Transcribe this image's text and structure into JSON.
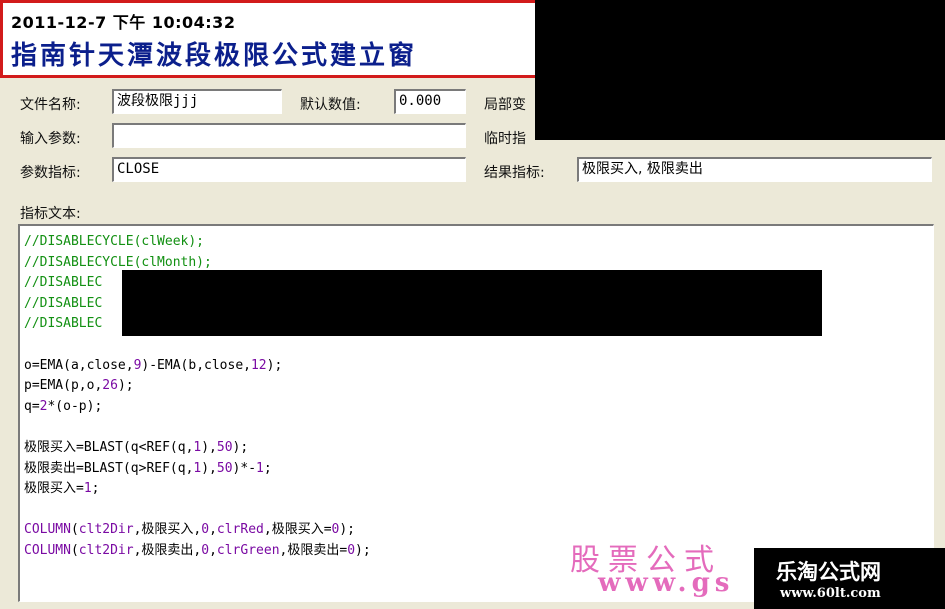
{
  "header": {
    "timestamp": "2011-12-7 下午 10:04:32",
    "title": "指南针天潭波段极限公式建立窗"
  },
  "form": {
    "file_name_label": "文件名称:",
    "file_name_value": "波段极限jjj",
    "default_value_label": "默认数值:",
    "default_value_value": "0.000",
    "local_var_label": "局部变",
    "input_params_label": "输入参数:",
    "input_params_value": "",
    "temp_label": "临时指",
    "param_index_label": "参数指标:",
    "param_index_value": "CLOSE",
    "result_index_label": "结果指标:",
    "result_index_value": "极限买入, 极限卖出",
    "index_text_label": "指标文本:"
  },
  "code": {
    "lines": [
      [
        {
          "t": "//DISABLECYCLE(clWeek);",
          "c": "cmt"
        }
      ],
      [
        {
          "t": "//DISABLECYCLE(clMonth);",
          "c": "cmt"
        }
      ],
      [
        {
          "t": "//DISABLEC",
          "c": "cmt"
        }
      ],
      [
        {
          "t": "//DISABLEC",
          "c": "cmt"
        }
      ],
      [
        {
          "t": "//DISABLEC",
          "c": "cmt"
        }
      ],
      [],
      [
        {
          "t": "o=EMA(a,close,",
          "c": "txt"
        },
        {
          "t": "9",
          "c": "fn"
        },
        {
          "t": ")-EMA(b,close,",
          "c": "txt"
        },
        {
          "t": "12",
          "c": "fn"
        },
        {
          "t": ");",
          "c": "txt"
        }
      ],
      [
        {
          "t": "p=EMA(p,o,",
          "c": "txt"
        },
        {
          "t": "26",
          "c": "fn"
        },
        {
          "t": ");",
          "c": "txt"
        }
      ],
      [
        {
          "t": "q=",
          "c": "txt"
        },
        {
          "t": "2",
          "c": "fn"
        },
        {
          "t": "*(o-p);",
          "c": "txt"
        }
      ],
      [],
      [
        {
          "t": "极限买入=BLAST(q<REF(q,",
          "c": "txt"
        },
        {
          "t": "1",
          "c": "fn"
        },
        {
          "t": "),",
          "c": "txt"
        },
        {
          "t": "50",
          "c": "fn"
        },
        {
          "t": ");",
          "c": "txt"
        }
      ],
      [
        {
          "t": "极限卖出=BLAST(q>REF(q,",
          "c": "txt"
        },
        {
          "t": "1",
          "c": "fn"
        },
        {
          "t": "),",
          "c": "txt"
        },
        {
          "t": "50",
          "c": "fn"
        },
        {
          "t": ")*-",
          "c": "txt"
        },
        {
          "t": "1",
          "c": "fn"
        },
        {
          "t": ";",
          "c": "txt"
        }
      ],
      [
        {
          "t": "极限买入=",
          "c": "txt"
        },
        {
          "t": "1",
          "c": "fn"
        },
        {
          "t": ";",
          "c": "txt"
        }
      ],
      [],
      [
        {
          "t": "COLUMN",
          "c": "fn"
        },
        {
          "t": "(",
          "c": "txt"
        },
        {
          "t": "clt2Dir",
          "c": "fn"
        },
        {
          "t": ",极限买入,",
          "c": "txt"
        },
        {
          "t": "0",
          "c": "fn"
        },
        {
          "t": ",",
          "c": "txt"
        },
        {
          "t": "clrRed",
          "c": "fn"
        },
        {
          "t": ",极限买入=",
          "c": "txt"
        },
        {
          "t": "0",
          "c": "fn"
        },
        {
          "t": ");",
          "c": "txt"
        }
      ],
      [
        {
          "t": "COLUMN",
          "c": "fn"
        },
        {
          "t": "(",
          "c": "txt"
        },
        {
          "t": "clt2Dir",
          "c": "fn"
        },
        {
          "t": ",极限卖出,",
          "c": "txt"
        },
        {
          "t": "0",
          "c": "fn"
        },
        {
          "t": ",",
          "c": "txt"
        },
        {
          "t": "clrGreen",
          "c": "fn"
        },
        {
          "t": ",极限卖出=",
          "c": "txt"
        },
        {
          "t": "0",
          "c": "fn"
        },
        {
          "t": ");",
          "c": "txt"
        }
      ]
    ]
  },
  "watermark": {
    "line1": "股票公式",
    "line2": "www.gs",
    "logo_line1": "乐淘公式网",
    "logo_line2": "www.60lt.com"
  },
  "colors": {
    "comment": "#129012",
    "keyword": "#7a0aa3",
    "title": "#0b1f8c",
    "banner_border": "#d21b1b",
    "watermark": "#e25bb5"
  }
}
